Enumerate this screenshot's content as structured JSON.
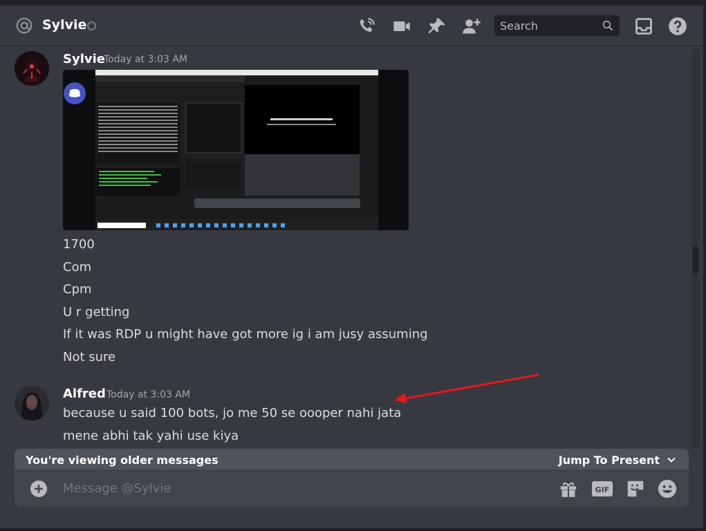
{
  "header": {
    "channel_name": "Sylvie",
    "icons": [
      "at-icon",
      "voice-call-icon",
      "video-call-icon",
      "pin-icon",
      "add-friend-icon",
      "inbox-icon",
      "help-icon"
    ],
    "search_placeholder": "Search"
  },
  "messages": [
    {
      "author": "Sylvie",
      "timestamp": "Today at 3:03 AM",
      "attachment": "screenshot-image",
      "lines": [
        "1700",
        "Com",
        "Cpm",
        "U r getting",
        "If it was RDP u might have got more ig i am jusy assuming",
        "Not sure"
      ]
    },
    {
      "author": "Alfred",
      "timestamp": "Today at 3:03 AM",
      "lines": [
        "because u said 100 bots, jo me 50 se oooper nahi jata",
        "mene abhi tak yahi use kiya"
      ]
    }
  ],
  "banner": {
    "text": "You're viewing older messages",
    "jump_label": "Jump To Present"
  },
  "composer": {
    "placeholder": "Message @Sylvie",
    "icons": [
      "gift-icon",
      "gif-icon",
      "sticker-icon",
      "emoji-icon"
    ],
    "gif_label": "GIF"
  },
  "colors": {
    "background": "#36393f",
    "accent": "#5865f2",
    "annotation_arrow": "#e8171a"
  }
}
